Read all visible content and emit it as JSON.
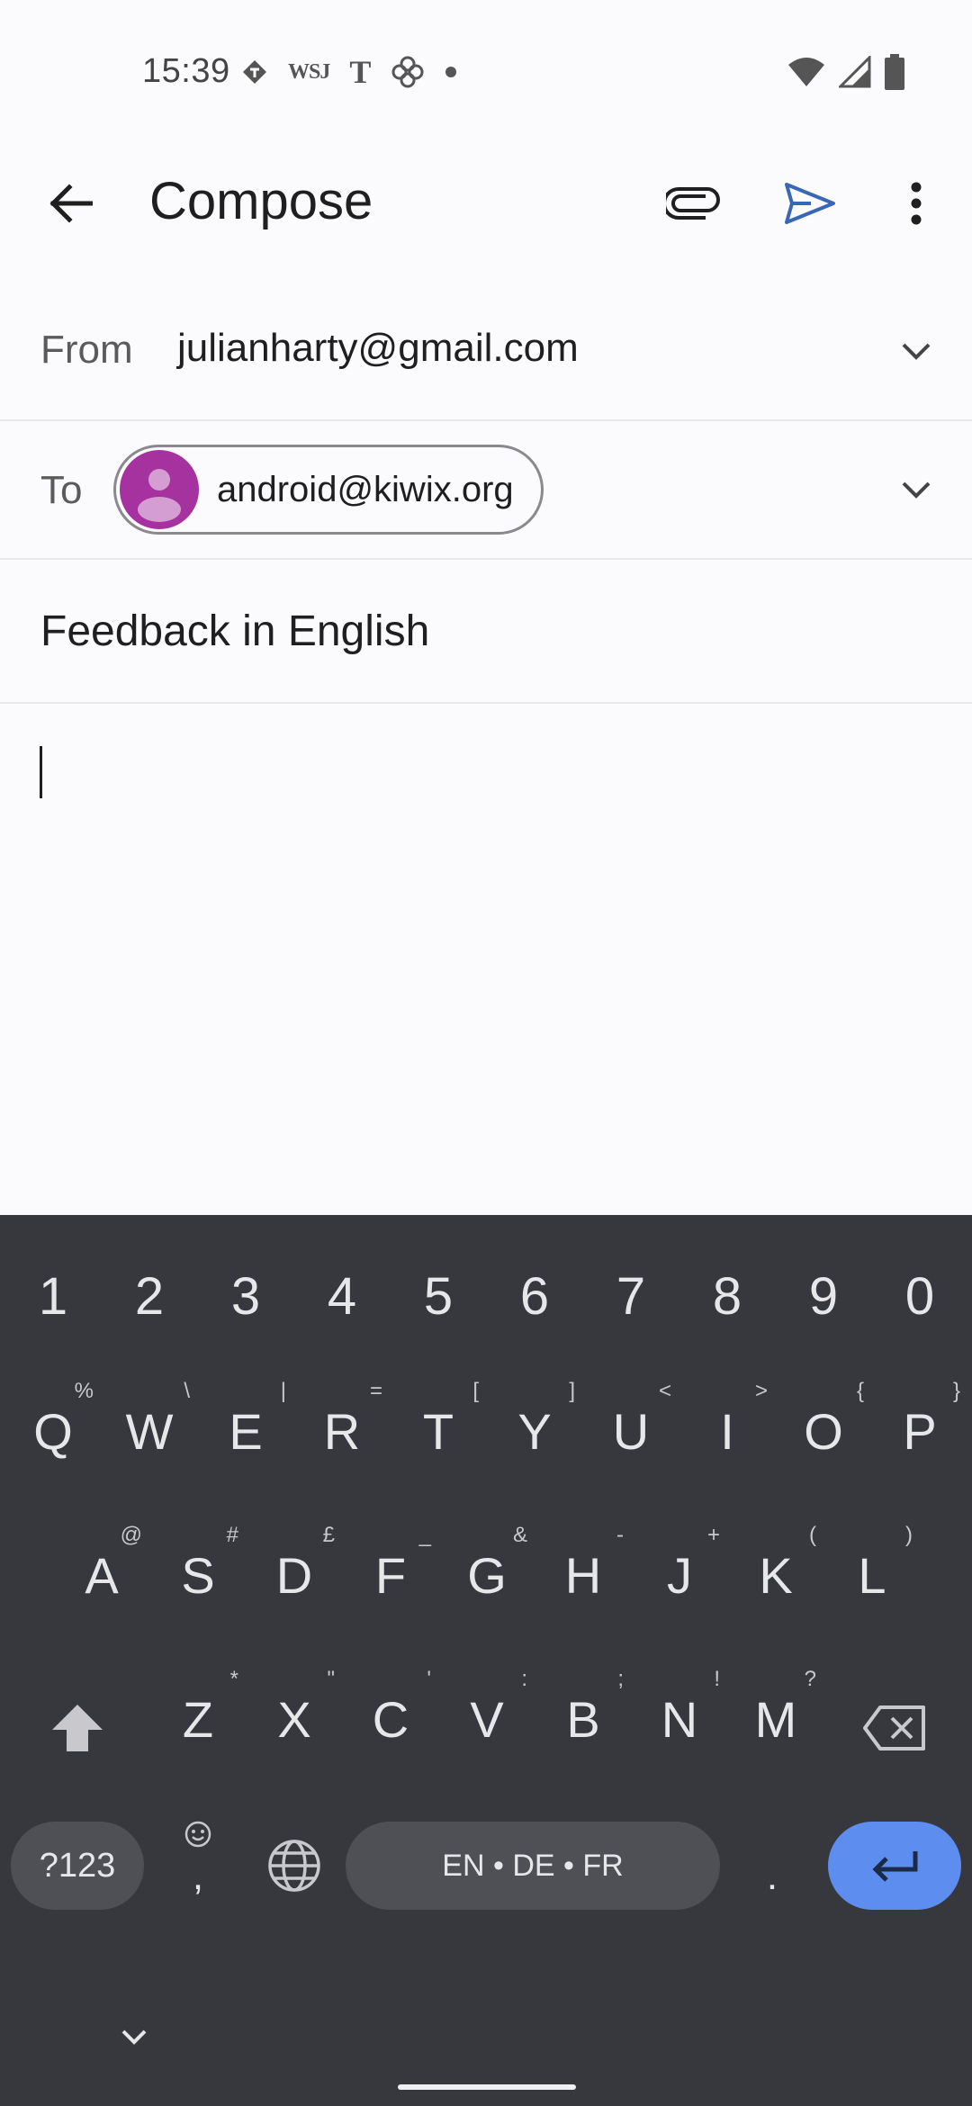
{
  "status_bar": {
    "time": "15:39",
    "notifications": [
      "tidal-icon",
      "WSJ",
      "T",
      "pinwheel-icon",
      "dot"
    ],
    "wsj_label": "WSJ",
    "nyt_label": "T"
  },
  "app_bar": {
    "title": "Compose"
  },
  "compose": {
    "from_label": "From",
    "from_value": "julianharty@gmail.com",
    "to_label": "To",
    "to_chip": "android@kiwix.org",
    "subject": "Feedback in English",
    "body": ""
  },
  "keyboard": {
    "numbers": [
      "1",
      "2",
      "3",
      "4",
      "5",
      "6",
      "7",
      "8",
      "9",
      "0"
    ],
    "row1": [
      {
        "key": "Q",
        "hint": "%"
      },
      {
        "key": "W",
        "hint": "\\"
      },
      {
        "key": "E",
        "hint": "|"
      },
      {
        "key": "R",
        "hint": "="
      },
      {
        "key": "T",
        "hint": "["
      },
      {
        "key": "Y",
        "hint": "]"
      },
      {
        "key": "U",
        "hint": "<"
      },
      {
        "key": "I",
        "hint": ">"
      },
      {
        "key": "O",
        "hint": "{"
      },
      {
        "key": "P",
        "hint": "}"
      }
    ],
    "row2": [
      {
        "key": "A",
        "hint": "@"
      },
      {
        "key": "S",
        "hint": "#"
      },
      {
        "key": "D",
        "hint": "£"
      },
      {
        "key": "F",
        "hint": "_"
      },
      {
        "key": "G",
        "hint": "&"
      },
      {
        "key": "H",
        "hint": "-"
      },
      {
        "key": "J",
        "hint": "+"
      },
      {
        "key": "K",
        "hint": "("
      },
      {
        "key": "L",
        "hint": ")"
      }
    ],
    "row3": [
      {
        "key": "Z",
        "hint": "*"
      },
      {
        "key": "X",
        "hint": "\""
      },
      {
        "key": "C",
        "hint": "'"
      },
      {
        "key": "V",
        "hint": ":"
      },
      {
        "key": "B",
        "hint": ";"
      },
      {
        "key": "N",
        "hint": "!"
      },
      {
        "key": "M",
        "hint": "?"
      }
    ],
    "symbols_label": "?123",
    "comma_label": ",",
    "space_label": "EN • DE • FR",
    "period_label": ".",
    "accent_color": "#5e8df0"
  }
}
